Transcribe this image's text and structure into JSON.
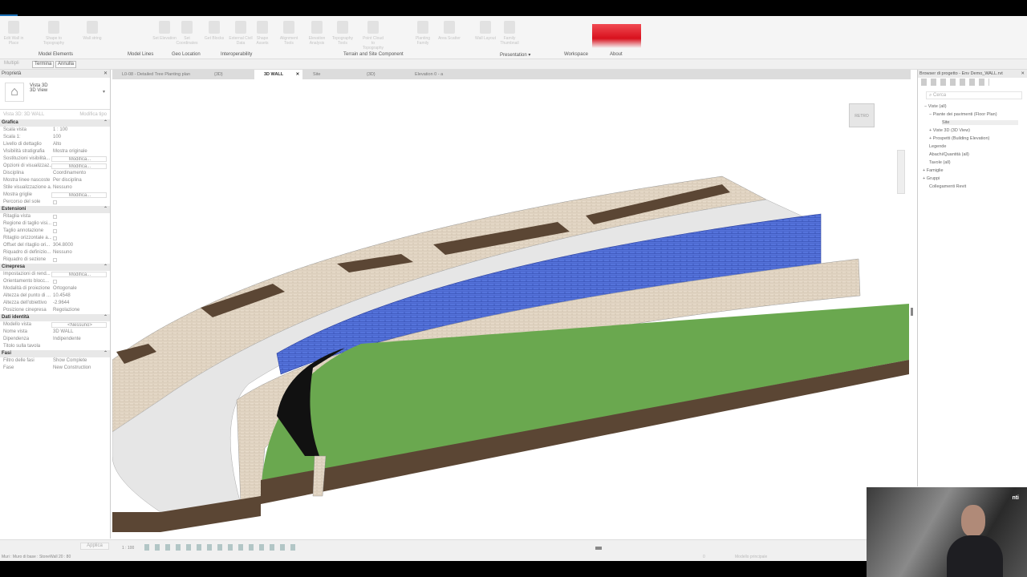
{
  "ribbon": {
    "buttons": [
      "Edit Wall in Place",
      "Shape to Topography",
      "Wall string",
      "Set Elevation",
      "Set Coordinates",
      "Get Blocks",
      "External Civil Data",
      "Shape Assets",
      "Alignment Tools",
      "Elevation Analysis",
      "Topography Tools",
      "Point Cloud to Topography",
      "Planting Family",
      "Area Scatter",
      "Wall Layout",
      "Family Thumbnail"
    ],
    "groups": [
      "Model Elements",
      "Model Lines",
      "Geo Location",
      "Interoperability",
      "Terrain and Site Component",
      "Presentation ▾",
      "Workspace",
      "About"
    ],
    "brand_color": "#d8101c"
  },
  "options_bar": {
    "multiple": "Multipli",
    "finish": "Termina",
    "cancel": "Annulla"
  },
  "properties": {
    "title": "Proprietà",
    "type_name": "Vista 3D",
    "type_sub": "3D View",
    "selector": "Vista 3D: 3D WALL",
    "edit_type": "Modifica tipo",
    "sections": [
      {
        "name": "Grafica",
        "rows": [
          [
            "Scala vista",
            "1 : 100"
          ],
          [
            "Scala 1:",
            "100"
          ],
          [
            "Livello di dettaglio",
            "Alto"
          ],
          [
            "Visibilità stratigrafia",
            "Mostra originale"
          ],
          [
            "Sostituzioni visibilità...",
            "Modifica..."
          ],
          [
            "Opzioni di visualizzaz...",
            "Modifica..."
          ],
          [
            "Disciplina",
            "Coordinamento"
          ],
          [
            "Mostra linee nascoste",
            "Per disciplina"
          ],
          [
            "Stile visualizzazione a...",
            "Nessuno"
          ],
          [
            "Mostra griglie",
            "Modifica..."
          ],
          [
            "Percorso del sole",
            ""
          ]
        ]
      },
      {
        "name": "Estensioni",
        "rows": [
          [
            "Ritaglia vista",
            ""
          ],
          [
            "Regione di taglio visi...",
            ""
          ],
          [
            "Taglio annotazione",
            ""
          ],
          [
            "Ritaglio orizzontale a...",
            ""
          ],
          [
            "Offset del ritaglio ori...",
            "304.8000"
          ],
          [
            "Riquadro di definizio...",
            "Nessuno"
          ],
          [
            "Riquadro di sezione",
            ""
          ]
        ]
      },
      {
        "name": "Cinepresa",
        "rows": [
          [
            "Impostazioni di rend...",
            "Modifica..."
          ],
          [
            "Orientamento blocc...",
            ""
          ],
          [
            "Modalità di proiezione",
            "Ortogonale"
          ],
          [
            "Altezza del punto di ...",
            "10.4548"
          ],
          [
            "Altezza dell'obiettivo",
            "-2.9644"
          ],
          [
            "Posizione cinepresa",
            "Regolazione"
          ]
        ]
      },
      {
        "name": "Dati identità",
        "rows": [
          [
            "Modello vista",
            "<Nessuno>"
          ],
          [
            "Nome vista",
            "3D WALL"
          ],
          [
            "Dipendenza",
            "Indipendente"
          ],
          [
            "Titolo sulla tavola",
            ""
          ]
        ]
      },
      {
        "name": "Fasi",
        "rows": [
          [
            "Filtro delle fasi",
            "Show Complete"
          ],
          [
            "Fase",
            "New Construction"
          ]
        ]
      }
    ],
    "apply": "Applica"
  },
  "tabs": [
    "L0-08 - Detailed Tree Planting plan",
    "{3D}",
    "3D WALL",
    "Site",
    "{3D}",
    "Elevation 0 - a"
  ],
  "active_tab": "3D WALL",
  "viewcube": "RETRO",
  "browser": {
    "title": "Browser di progetto - Env Demo_WALL.rvt",
    "search_placeholder": "Cerca",
    "items": [
      "Viste (all)",
      "Piante dei pavimenti (Floor Plan)",
      "Site",
      "Viste 3D (3D View)",
      "Prospetti (Building Elevation)",
      "Legende",
      "Abachi/Quantità (all)",
      "Tavole (all)",
      "Famiglie",
      "Gruppi",
      "Collegamenti Revit"
    ]
  },
  "status": {
    "scale": "1 : 100",
    "selection": "Muri : Muro di base : StoneWall 20 : 80",
    "model": "Modello principale",
    "filter_count": "0"
  },
  "colors": {
    "terrain": "#6aa84f",
    "wall_blue": "#4f6fd6",
    "stone": "#e8dccb",
    "base": "#5b4634"
  },
  "webcam": {
    "logo": "nti"
  }
}
